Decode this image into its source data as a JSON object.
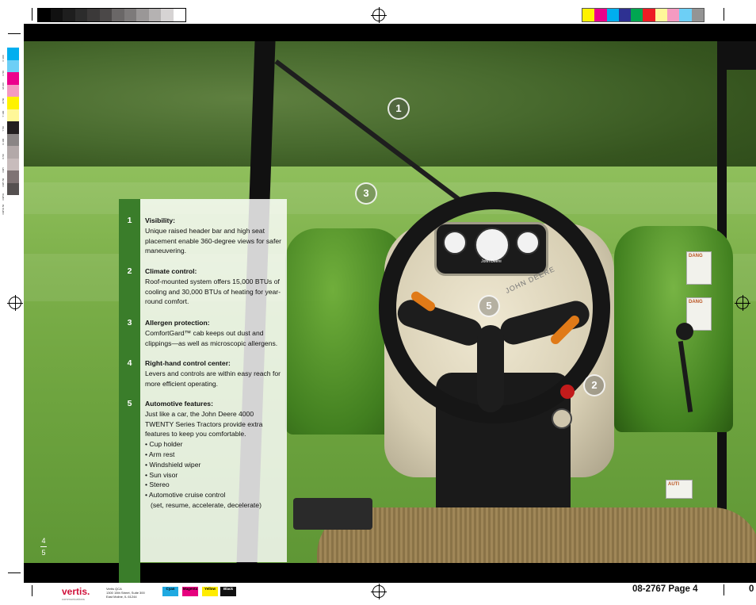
{
  "features": [
    {
      "num": "1",
      "title": "Visibility:",
      "body": "Unique raised header bar and high seat placement enable 360-degree views for safer maneuvering."
    },
    {
      "num": "2",
      "title": "Climate control:",
      "body": "Roof-mounted system offers 15,000 BTUs of cooling and 30,000 BTUs of heating for year-round comfort."
    },
    {
      "num": "3",
      "title": "Allergen protection:",
      "body": "ComfortGard™ cab keeps out dust and clippings—as well as microscopic allergens."
    },
    {
      "num": "4",
      "title": "Right-hand control center:",
      "body": "Levers and controls are within easy reach for more efficient operating."
    },
    {
      "num": "5",
      "title": "Automotive features:",
      "body": "Just like a car, the John Deere 4000 TWENTY Series Tractors provide extra features to keep you comfortable.",
      "bullets": [
        "• Cup holder",
        "• Arm rest",
        "• Windshield wiper",
        "• Sun visor",
        "• Stereo",
        "• Automotive cruise control",
        "(set, resume, accelerate, decelerate)"
      ]
    }
  ],
  "callouts": [
    "1",
    "3",
    "5",
    "2"
  ],
  "page_numbers": {
    "top": "4",
    "bottom": "5"
  },
  "brand_on_wheel": "JOHN DEERE",
  "dash_brand": "John Deere",
  "printer": {
    "logo": "vertis.",
    "logo_sub": "communications",
    "address_lines": [
      "Vertis QCA",
      "1300 15th Street, Suite 300",
      "East Moline, IL 61244"
    ],
    "swatches": [
      {
        "label": "Cyan",
        "color": "#1fa9e1"
      },
      {
        "label": "Magenta",
        "color": "#e6007e"
      },
      {
        "label": "Yellow",
        "color": "#ffec00"
      },
      {
        "label": "Black",
        "color": "#111111"
      }
    ],
    "job": "08-2767 Page 4",
    "edge_char": "0",
    "gray_steps": [
      "#000000",
      "#111111",
      "#1e1e1e",
      "#2c2c2c",
      "#3b3939",
      "#4b4848",
      "#6a6767",
      "#7d7a7a",
      "#9a9797",
      "#b5b2b2",
      "#d6d3d3",
      "#ffffff"
    ],
    "color_steps": [
      "#fff200",
      "#ec008c",
      "#00aeef",
      "#2e3192",
      "#00a651",
      "#ed1c24",
      "#fff799",
      "#f49ac1",
      "#6dcff6",
      "#949494"
    ],
    "side_steps": [
      "#00aeef",
      "#6dcff6",
      "#ec008c",
      "#f49ac1",
      "#fff200",
      "#fff799",
      "#231f20",
      "#8a8585",
      "#b3a9a9",
      "#c8bcbc",
      "#7f7374",
      "#555050"
    ],
    "side_codes": [
      "C 100",
      "C 50",
      "M 100",
      "M 50",
      "Y 100",
      "Y 50",
      "K 100",
      "K 50",
      "CMY",
      "CMY 50",
      "CMYK",
      "CMYK 50"
    ]
  },
  "warning_labels": [
    "DANG",
    "DANG",
    "AUTI"
  ]
}
